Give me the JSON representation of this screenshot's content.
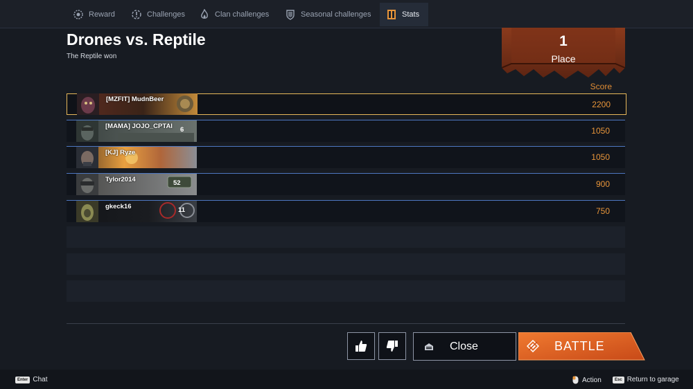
{
  "tabs": [
    {
      "label": "Reward",
      "icon": "gear-badge-icon",
      "active": false
    },
    {
      "label": "Challenges",
      "icon": "dashed-circle-icon",
      "active": false
    },
    {
      "label": "Clan challenges",
      "icon": "flame-icon",
      "active": false
    },
    {
      "label": "Seasonal challenges",
      "icon": "crest-icon",
      "active": false
    },
    {
      "label": "Stats",
      "icon": "book-icon",
      "active": true
    }
  ],
  "match": {
    "title": "Drones vs. Reptile",
    "subtitle": "The Reptile won"
  },
  "place": {
    "number": "1",
    "label": "Place"
  },
  "score_header": "Score",
  "players": [
    {
      "name": "[MZFIT] MudnBeer",
      "badge": "",
      "score": "2200"
    },
    {
      "name": "[MAMA] JOJO_CPTAI",
      "badge": "6",
      "score": "1050"
    },
    {
      "name": "[KJ] Ryze",
      "badge": "",
      "score": "1050"
    },
    {
      "name": "Tylor2014",
      "badge": "52",
      "score": "900"
    },
    {
      "name": "gkeck16",
      "badge": "11",
      "score": "750"
    }
  ],
  "buttons": {
    "close": "Close",
    "battle": "BATTLE"
  },
  "footer": {
    "chat_key": "Enter",
    "chat": "Chat",
    "action": "Action",
    "return_key": "Esc",
    "return": "Return to garage"
  },
  "colors": {
    "accent": "#e8632a",
    "score": "#e8953a",
    "row_border": "#4e78c2",
    "highlight": "#e8b85a"
  }
}
